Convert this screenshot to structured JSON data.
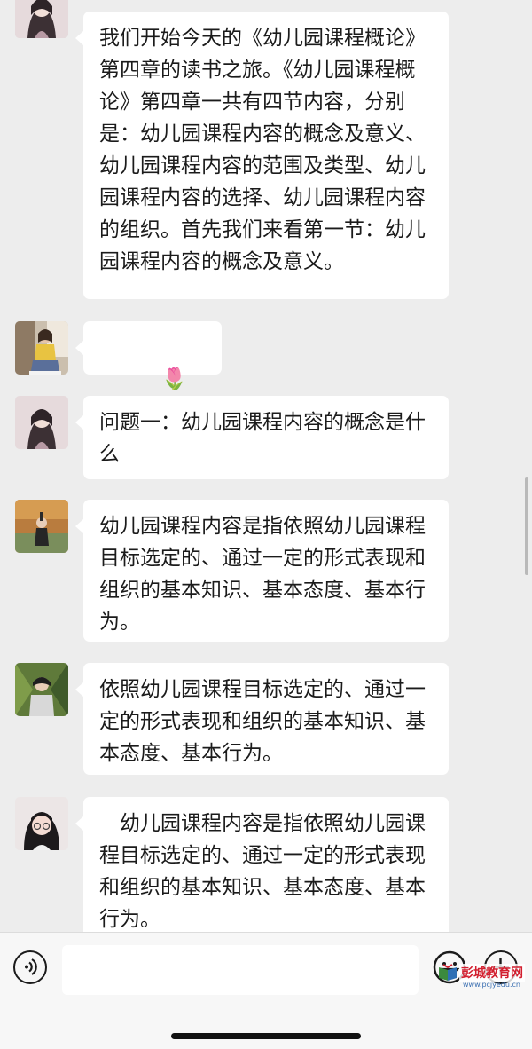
{
  "messages": [
    {
      "text": "我们开始今天的《幼儿园课程概论》第四章的读书之旅。《幼儿园课程概论》第四章一共有四节内容，分别是：幼儿园课程内容的概念及意义、幼儿园课程内容的范围及类型、幼儿园课程内容的选择、幼儿园课程内容的组织。首先我们来看第一节：幼儿园课程内容的概念及意义。"
    },
    {
      "text": "🌷🌷🌷🌷",
      "emoji_name": "tulip-emoji"
    },
    {
      "text": "问题一：幼儿园课程内容的概念是什么"
    },
    {
      "text": "幼儿园课程内容是指依照幼儿园课程目标选定的、通过一定的形式表现和组织的基本知识、基本态度、基本行为。"
    },
    {
      "text": "依照幼儿园课程目标选定的、通过一定的形式表现和组织的基本知识、基本态度、基本行为。"
    },
    {
      "text": "　幼儿园课程内容是指依照幼儿园课程目标选定的、通过一定的形式表现和组织的基本知识、基本态度、基本行为。"
    }
  ],
  "input_bar": {
    "voice_icon": "voice-icon",
    "emoji_icon": "emoji-icon",
    "plus_icon": "plus-icon",
    "input_value": ""
  },
  "watermark": {
    "title": "彭城教育网",
    "url": "www.pcjyedu.cn"
  },
  "colors": {
    "background": "#ededed",
    "bubble": "#ffffff",
    "text": "#1b1b1b"
  }
}
